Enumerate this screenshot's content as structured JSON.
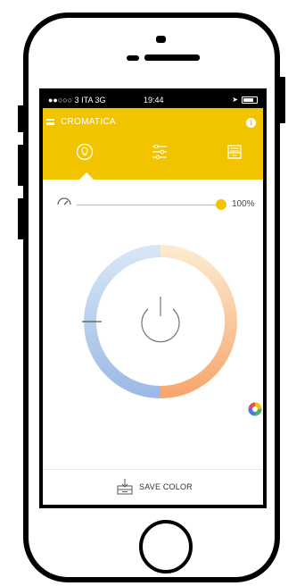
{
  "status_bar": {
    "carrier": "●●○○○ 3 ITA  3G",
    "time": "19:44"
  },
  "app_bar": {
    "title": "CROMATICA"
  },
  "tabs": [
    {
      "icon": "bulb-icon"
    },
    {
      "icon": "sliders-icon"
    },
    {
      "icon": "inbox-icon"
    }
  ],
  "brightness": {
    "label": "100%",
    "value": 1.0
  },
  "wheel": {
    "colors": {
      "cool": "#9bb8e6",
      "warm": "#f7a56a",
      "light_cool": "#d8e8f5",
      "light_warm": "#fde6c4"
    }
  },
  "footer": {
    "save_label": "SAVE COLOR"
  },
  "colors": {
    "accent": "#f2c400"
  }
}
